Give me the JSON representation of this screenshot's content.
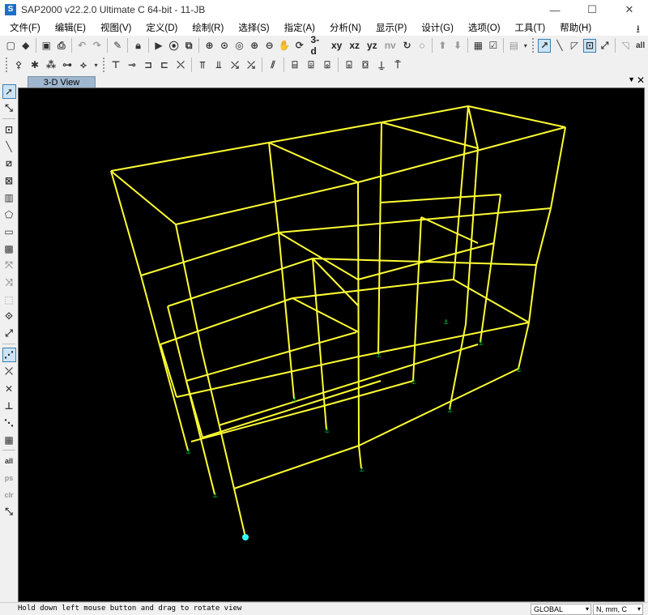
{
  "window": {
    "title": "SAP2000 v22.2.0 Ultimate C 64-bit - 11-JB",
    "logo": "S",
    "minimize_icon": "—",
    "maximize_icon": "☐",
    "close_icon": "✕"
  },
  "menu": [
    {
      "label": "文件(F)"
    },
    {
      "label": "编辑(E)"
    },
    {
      "label": "视图(V)"
    },
    {
      "label": "定义(D)"
    },
    {
      "label": "绘制(R)"
    },
    {
      "label": "选择(S)"
    },
    {
      "label": "指定(A)"
    },
    {
      "label": "分析(N)"
    },
    {
      "label": "显示(P)"
    },
    {
      "label": "设计(G)"
    },
    {
      "label": "选项(O)"
    },
    {
      "label": "工具(T)"
    },
    {
      "label": "帮助(H)"
    }
  ],
  "toolbar1": {
    "view_3d": "3-d",
    "view_xy": "xy",
    "view_xz": "xz",
    "view_yz": "yz",
    "view_nv": "nv",
    "all_label": "all"
  },
  "tab": {
    "label": "3-D View",
    "dropdown_icon": "▼",
    "close_icon": "✕"
  },
  "viewport": {
    "background": "#000000",
    "frame_color": "#ffff33",
    "support_color": "#00cc44",
    "selected_joint_color": "#33ffff"
  },
  "status": {
    "message": "Hold down left mouse button and drag to rotate view",
    "coord_system": "GLOBAL",
    "units": "N, mm, C"
  }
}
